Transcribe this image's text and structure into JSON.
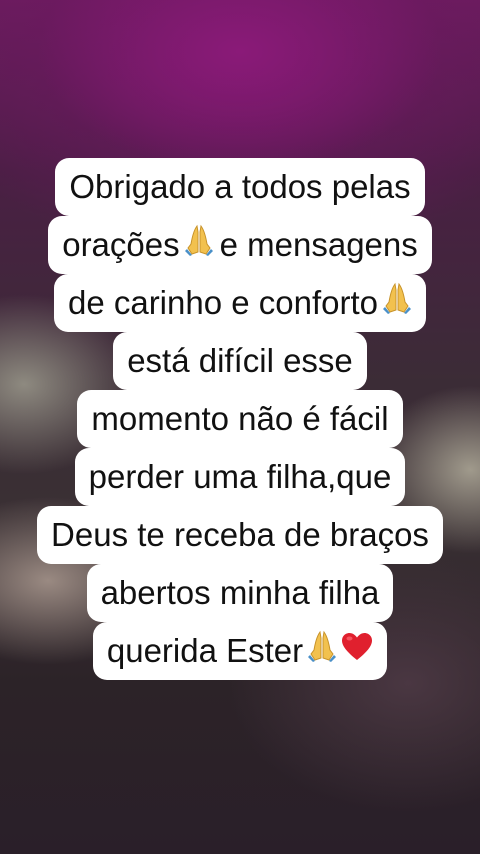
{
  "caption": {
    "lines": [
      {
        "text": "Obrigado a todos pelas",
        "emojis": []
      },
      {
        "text": "orações",
        "emojis": [
          "praying-hands"
        ],
        "after": "e mensagens"
      },
      {
        "text": "de carinho e conforto",
        "emojis": [
          "praying-hands"
        ]
      },
      {
        "text": "está difícil esse",
        "emojis": []
      },
      {
        "text": "momento não é fácil",
        "emojis": []
      },
      {
        "text": "perder uma filha,que",
        "emojis": []
      },
      {
        "text": "Deus te receba de braços",
        "emojis": []
      },
      {
        "text": "abertos minha filha",
        "emojis": []
      },
      {
        "text": "querida Ester",
        "emojis": [
          "praying-hands",
          "red-heart"
        ]
      }
    ]
  },
  "colors": {
    "caption_bg": "#ffffff",
    "caption_text": "#111111",
    "bg_top": "#6b1c5e",
    "bg_bottom": "#2a1f29"
  }
}
